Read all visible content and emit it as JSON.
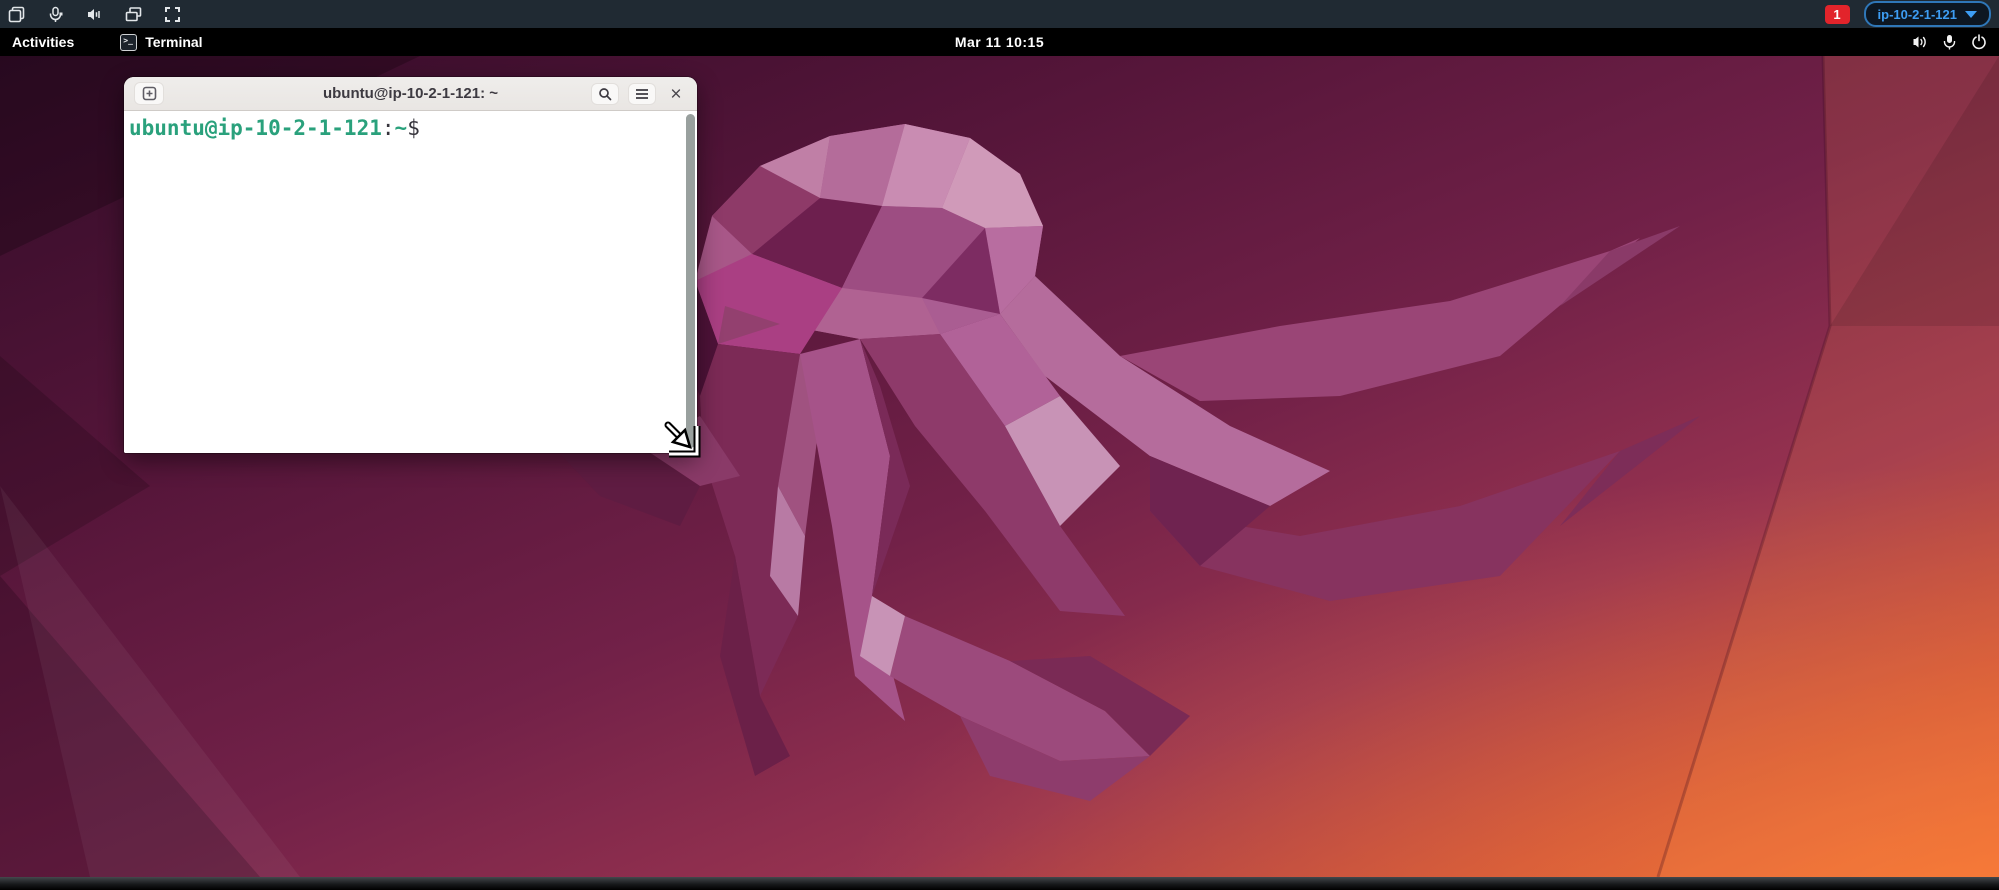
{
  "vnc_toolbar": {
    "icons": [
      "clipboard-copy",
      "microphone",
      "speaker",
      "windows",
      "fullscreen"
    ],
    "notification_count": "1",
    "host_button": {
      "label": "ip-10-2-1-121",
      "caret": "down",
      "accent_color": "#3d9df3"
    }
  },
  "top_bar": {
    "activities_label": "Activities",
    "app_indicator": {
      "label": "Terminal",
      "icon": "terminal-icon"
    },
    "clock": "Mar 11 10:15",
    "status_icons": [
      "volume",
      "microphone",
      "power"
    ]
  },
  "terminal": {
    "title": "ubuntu@ip-10-2-1-121: ~",
    "titlebar_buttons": [
      "new-tab",
      "search",
      "menu",
      "close"
    ],
    "prompt": {
      "user_host": "ubuntu@ip-10-2-1-121",
      "colon": ":",
      "path": "~",
      "symbol": "$"
    }
  },
  "colors": {
    "toolbar_bg": "#202a33",
    "badge_red": "#e2242b",
    "host_accent": "#3d9df3",
    "prompt_green": "#2aa17c",
    "titlebar_bg": "#ebe8e6",
    "wallpaper_dark": "#350d2a",
    "wallpaper_orange": "#e65a2e",
    "jellyfish_pink": "#b56c9c"
  }
}
